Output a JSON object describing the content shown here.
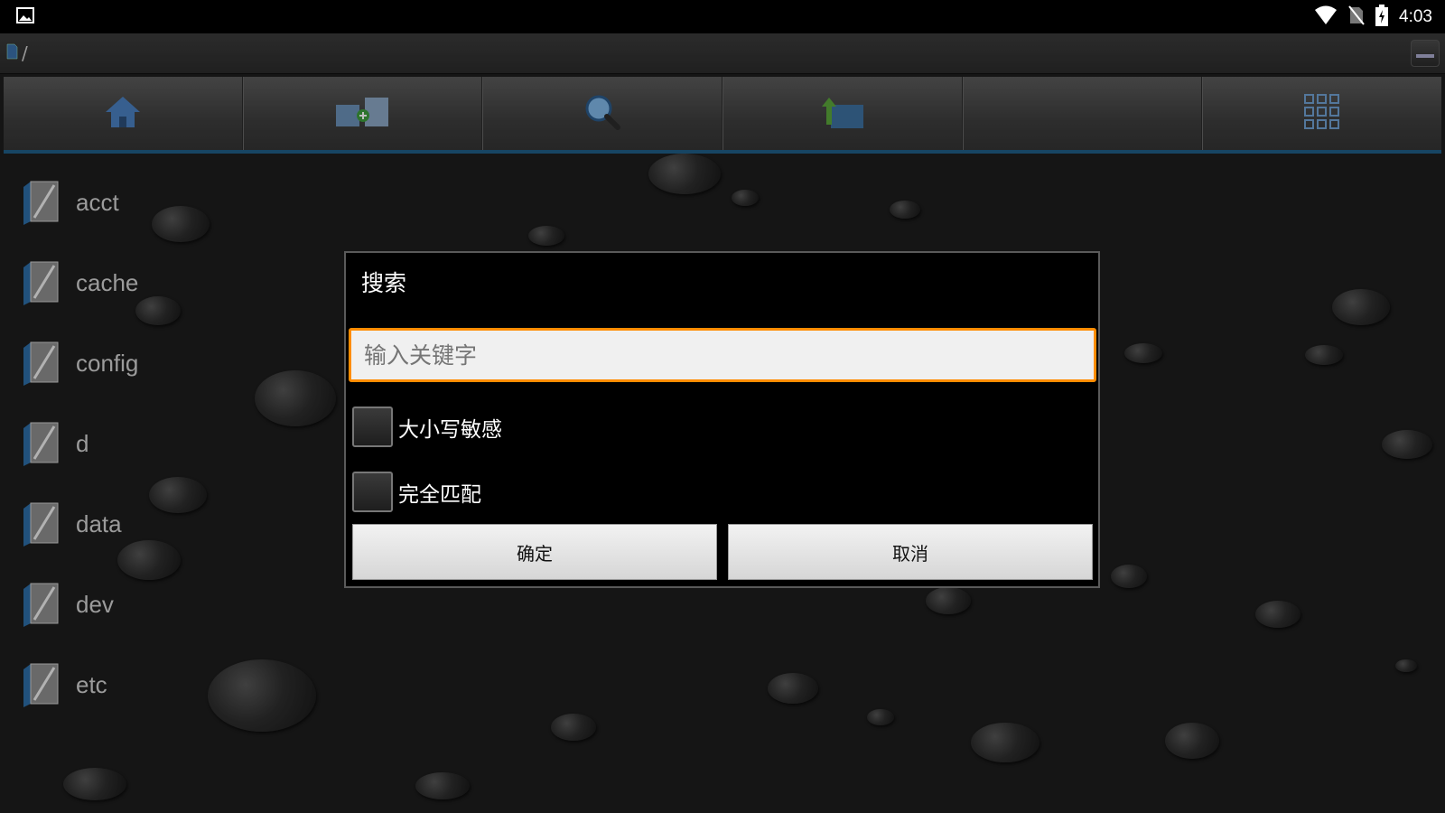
{
  "status_bar": {
    "time": "4:03",
    "icons": [
      "image-notification-icon",
      "wifi-icon",
      "no-sim-icon",
      "battery-charging-icon"
    ]
  },
  "path_bar": {
    "path": "/",
    "icons": [
      "sdcard-icon",
      "collapse-icon"
    ]
  },
  "toolbar": {
    "buttons": [
      "home-icon",
      "new-folder-icon",
      "search-icon",
      "up-folder-icon",
      "empty",
      "grid-view-icon"
    ]
  },
  "files": [
    {
      "name": "acct"
    },
    {
      "name": "cache"
    },
    {
      "name": "config"
    },
    {
      "name": "d"
    },
    {
      "name": "data"
    },
    {
      "name": "dev"
    },
    {
      "name": "etc"
    }
  ],
  "dialog": {
    "title": "搜索",
    "input_placeholder": "输入关键字",
    "input_value": "",
    "case_sensitive_label": "大小写敏感",
    "case_sensitive_checked": false,
    "exact_match_label": "完全匹配",
    "exact_match_checked": false,
    "ok_label": "确定",
    "cancel_label": "取消"
  },
  "colors": {
    "input_focus_border": "#ff8c00",
    "toolbar_accent": "#1f5d85"
  }
}
